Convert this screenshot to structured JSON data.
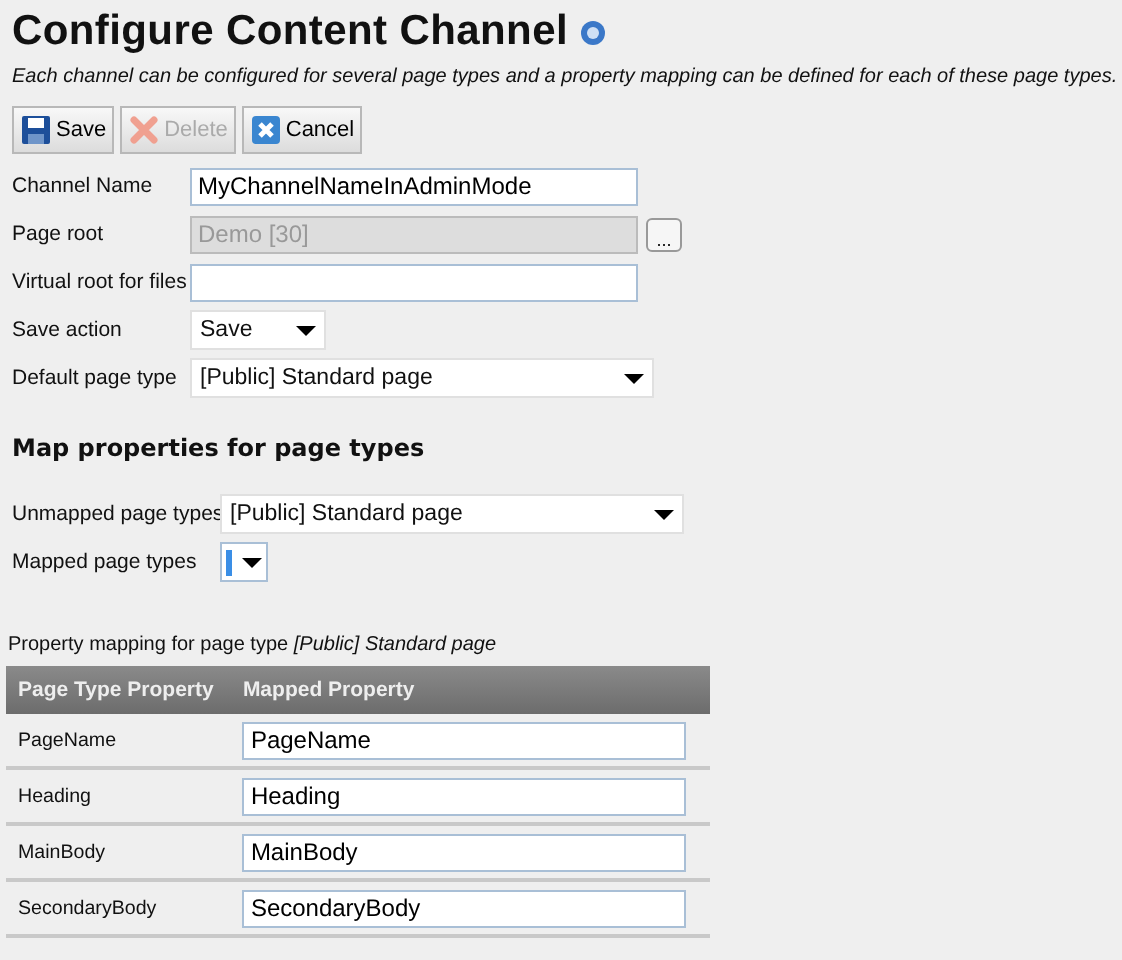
{
  "title": "Configure Content Channel",
  "description": "Each channel can be configured for several page types and a property mapping can be defined for each of these page types.",
  "toolbar": [
    {
      "label": "Save",
      "disabled": false
    },
    {
      "label": "Delete",
      "disabled": true
    },
    {
      "label": "Cancel",
      "disabled": false
    }
  ],
  "fields": [
    {
      "label": "Channel Name",
      "kind": "text",
      "value": "MyChannelNameInAdminMode",
      "disabled": false
    },
    {
      "label": "Page root",
      "kind": "picker",
      "value": "Demo [30]",
      "disabled": true,
      "button": "..."
    },
    {
      "label": "Virtual root for files",
      "kind": "text",
      "disabled": false
    },
    {
      "label": "Save action",
      "kind": "select",
      "value": "Save"
    },
    {
      "label": "Default page type",
      "kind": "select",
      "value": "[Public] Standard page"
    }
  ],
  "mapping": {
    "heading": "Map properties for page types",
    "fields": [
      {
        "label": "Unmapped page types",
        "kind": "select",
        "value": "[Public] Standard page"
      },
      {
        "label": "Mapped page types",
        "kind": "select"
      }
    ],
    "caption": "Property mapping for page type *[Public] Standard page*",
    "columns": [
      "Page Type Property",
      "Mapped Property"
    ],
    "rows": [
      {
        "property": "PageName",
        "mapped": "PageName"
      },
      {
        "property": "Heading",
        "mapped": "Heading"
      },
      {
        "property": "MainBody",
        "mapped": "MainBody"
      },
      {
        "property": "SecondaryBody",
        "mapped": "SecondaryBody"
      }
    ]
  }
}
